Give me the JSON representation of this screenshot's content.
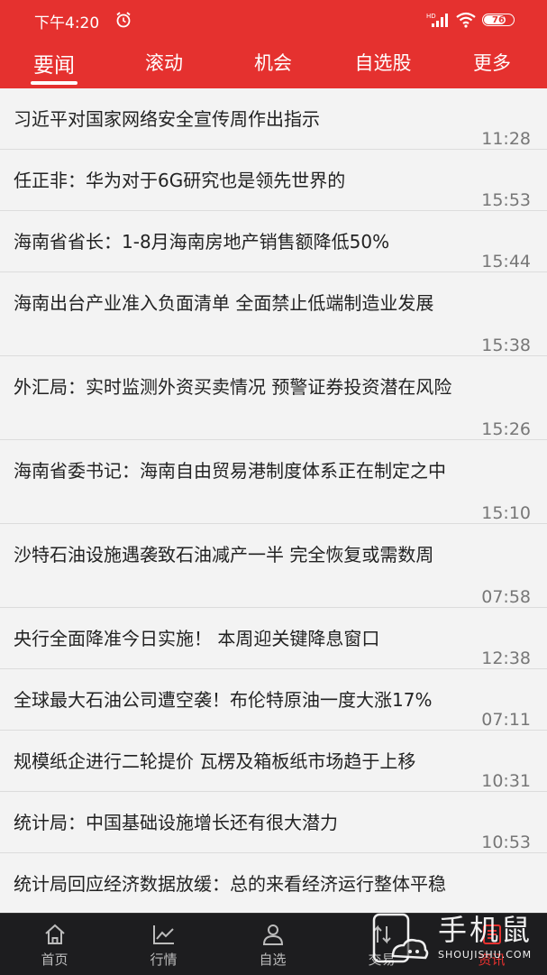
{
  "status_bar": {
    "time": "下午4:20",
    "network": "HD",
    "battery": "76",
    "battery_level": 0.76
  },
  "tabs": [
    {
      "label": "要闻",
      "active": true
    },
    {
      "label": "滚动",
      "active": false
    },
    {
      "label": "机会",
      "active": false
    },
    {
      "label": "自选股",
      "active": false
    },
    {
      "label": "更多",
      "active": false
    }
  ],
  "news": [
    {
      "title": "习近平对国家网络安全宣传周作出指示",
      "time": "11:28"
    },
    {
      "title": "任正非：华为对于6G研究也是领先世界的",
      "time": "15:53"
    },
    {
      "title": "海南省省长：1-8月海南房地产销售额降低50%",
      "time": "15:44"
    },
    {
      "title": "海南出台产业准入负面清单 全面禁止低端制造业发展",
      "time": "15:38"
    },
    {
      "title": "外汇局：实时监测外资买卖情况 预警证券投资潜在风险",
      "time": "15:26"
    },
    {
      "title": "海南省委书记：海南自由贸易港制度体系正在制定之中",
      "time": "15:10"
    },
    {
      "title": "沙特石油设施遇袭致石油减产一半 完全恢复或需数周",
      "time": "07:58"
    },
    {
      "title": "央行全面降准今日实施！ 本周迎关键降息窗口",
      "time": "12:38"
    },
    {
      "title": "全球最大石油公司遭空袭！布伦特原油一度大涨17%",
      "time": "07:11"
    },
    {
      "title": "规模纸企进行二轮提价 瓦楞及箱板纸市场趋于上移",
      "time": "10:31"
    },
    {
      "title": "统计局：中国基础设施增长还有很大潜力",
      "time": "10:53"
    },
    {
      "title": "统计局回应经济数据放缓：总的来看经济运行整体平稳",
      "time": ""
    }
  ],
  "bottom_nav": [
    {
      "label": "首页",
      "icon": "home-icon",
      "active": false
    },
    {
      "label": "行情",
      "icon": "chart-icon",
      "active": false
    },
    {
      "label": "自选",
      "icon": "user-icon",
      "active": false
    },
    {
      "label": "交易",
      "icon": "trade-icon",
      "active": false
    },
    {
      "label": "资讯",
      "icon": "news-icon",
      "active": true
    }
  ],
  "watermark": {
    "title": "手机鼠",
    "subtitle": "SHOUJISHU.COM"
  },
  "colors": {
    "brand_red": "#e5312f",
    "nav_bg": "#1d1d1f"
  }
}
